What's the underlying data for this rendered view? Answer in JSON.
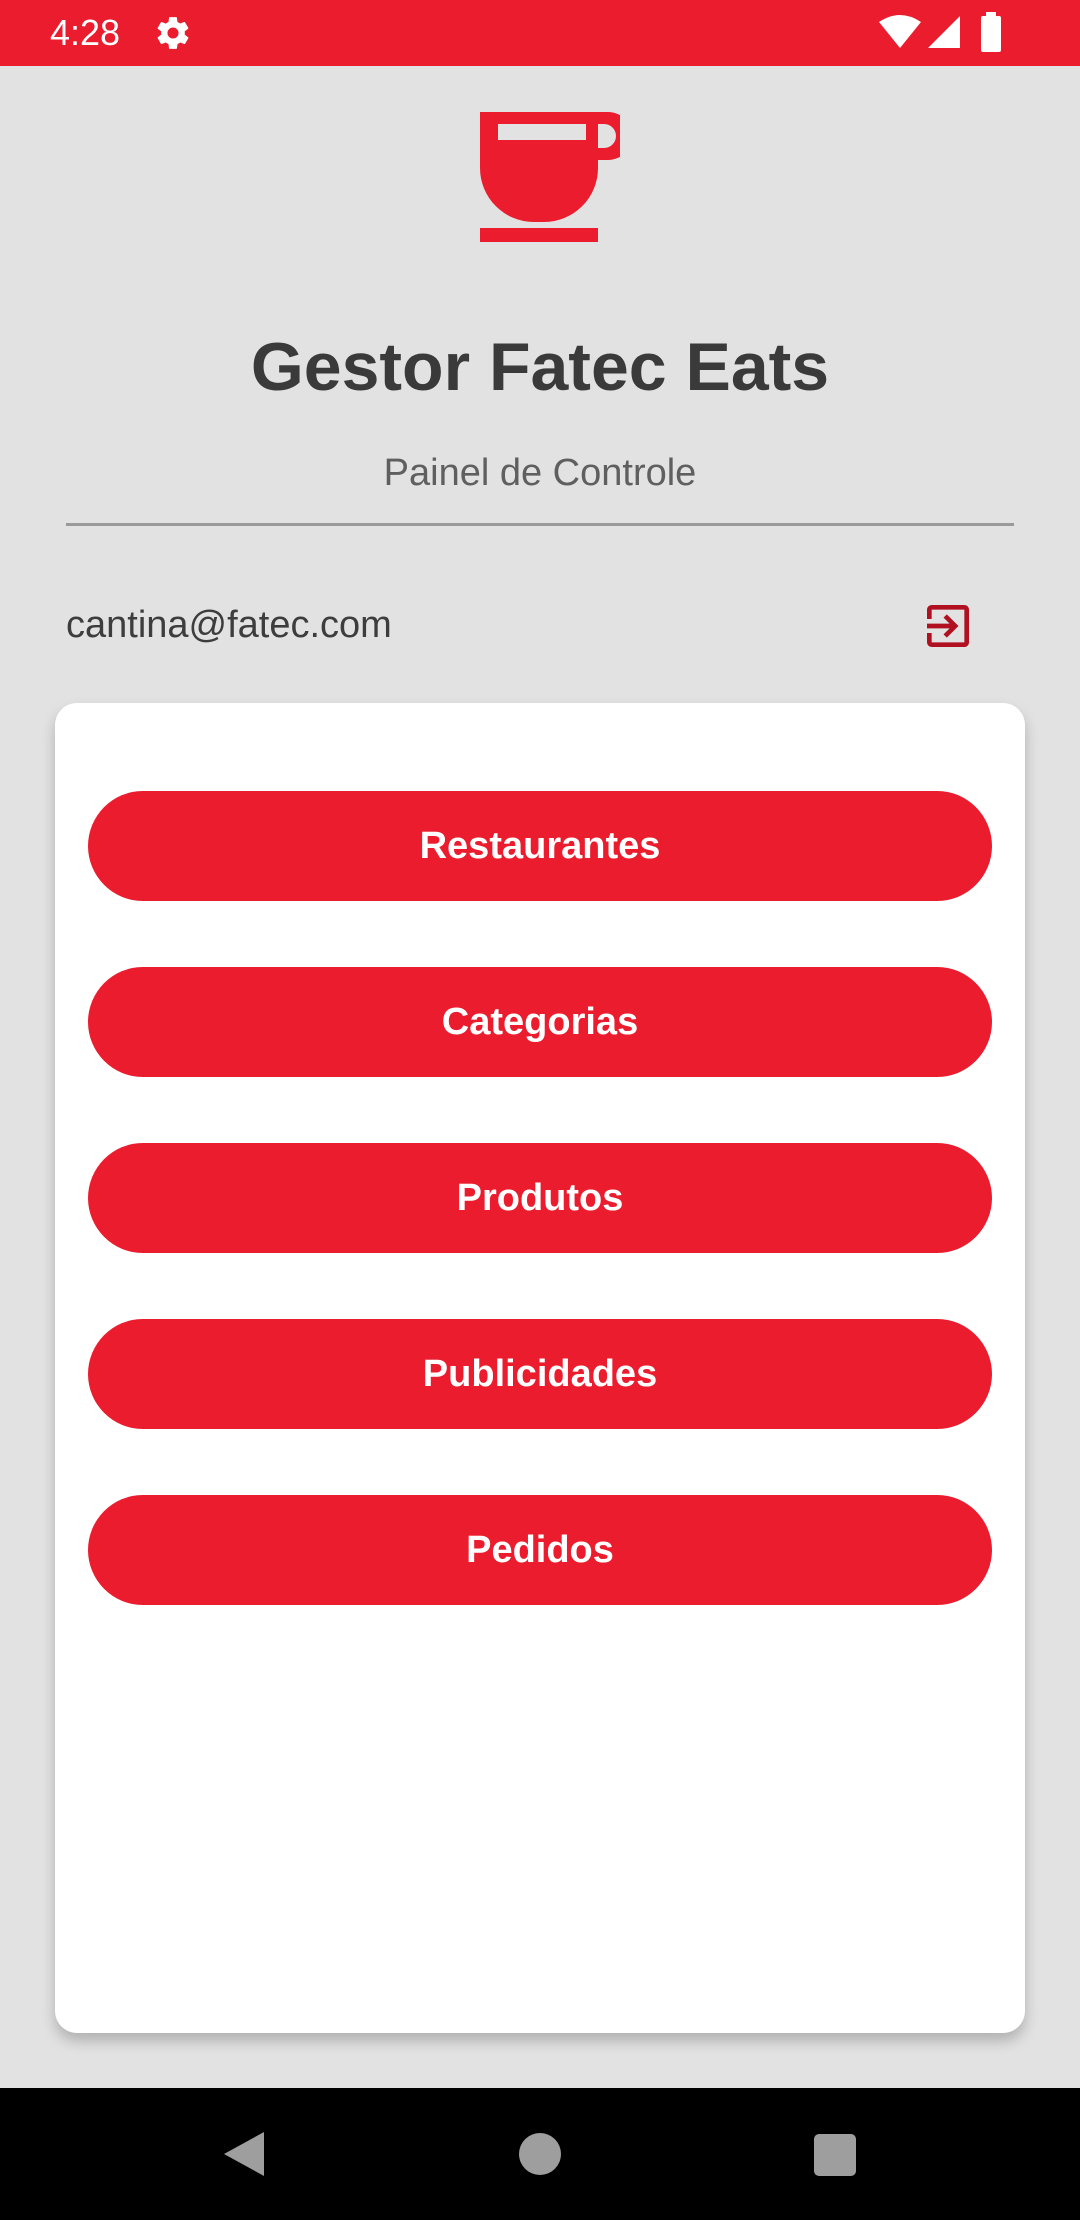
{
  "status_bar": {
    "time": "4:28",
    "icons": [
      "gear-icon",
      "wifi-icon",
      "signal-icon",
      "battery-icon"
    ]
  },
  "header": {
    "logo_icon": "coffee-cup-icon",
    "title": "Gestor Fatec Eats",
    "subtitle": "Painel de Controle"
  },
  "account": {
    "email": "cantina@fatec.com",
    "logout_icon": "logout-icon"
  },
  "menu": {
    "items": [
      {
        "label": "Restaurantes"
      },
      {
        "label": "Categorias"
      },
      {
        "label": "Produtos"
      },
      {
        "label": "Publicidades"
      },
      {
        "label": "Pedidos"
      }
    ]
  },
  "nav_bar": {
    "icons": [
      "back-icon",
      "home-icon",
      "recents-icon"
    ]
  },
  "colors": {
    "accent": "#ea1c2d",
    "logout_icon": "#b01020",
    "background": "#e2e2e2",
    "card": "#ffffff",
    "title_text": "#3a3a3a"
  }
}
